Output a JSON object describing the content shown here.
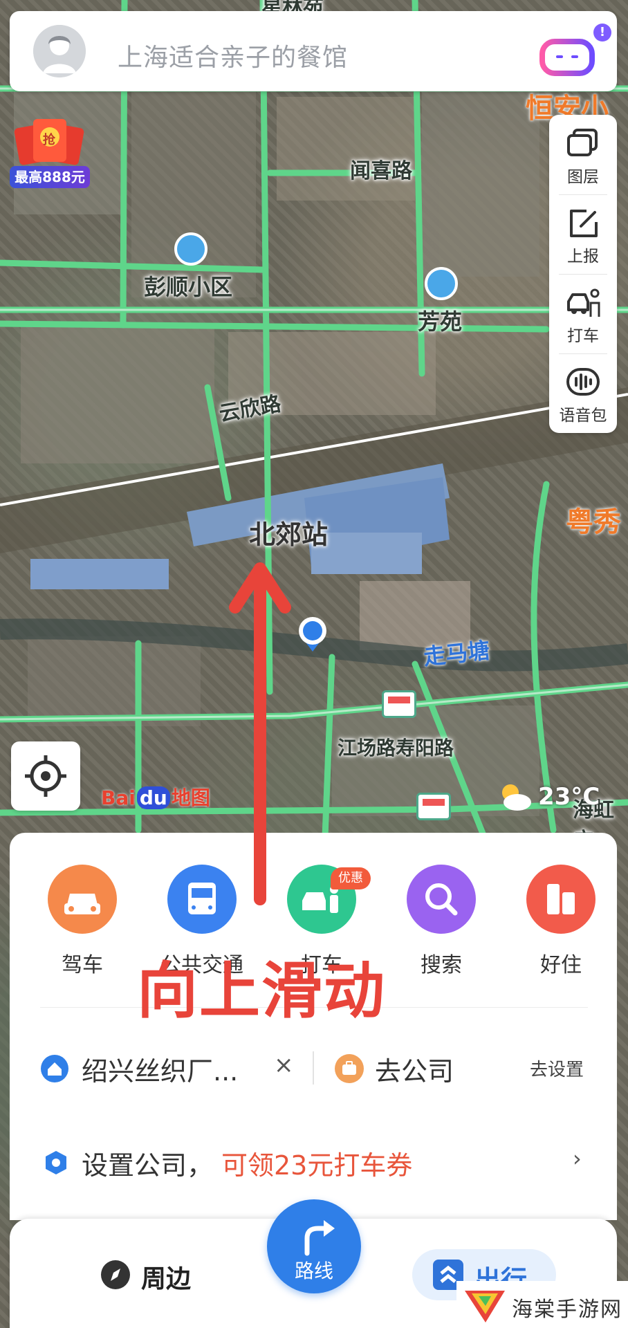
{
  "search": {
    "placeholder": "上海适合亲子的餐馆",
    "assistant_badge": "!"
  },
  "promo": {
    "label": "最高888元",
    "envelope_text": "抢"
  },
  "toolbar": {
    "items": [
      {
        "label": "图层",
        "icon": "layers-icon"
      },
      {
        "label": "上报",
        "icon": "report-icon"
      },
      {
        "label": "打车",
        "icon": "taxi-icon"
      },
      {
        "label": "语音包",
        "icon": "voice-pack-icon"
      }
    ]
  },
  "map": {
    "labels": {
      "top_partial": "星林苑",
      "top_right_partial": "恒安小",
      "wenxi_road": "闻喜路",
      "pengshun": "彭顺小区",
      "fangyuan": "芳苑",
      "yunxin_road": "云欣路",
      "beijiao_station": "北郊站",
      "yuexiu_partial": "粤秀",
      "zoumatang": "走马塘",
      "jiangchang": "江场路寿阳路",
      "haihong_partial": "海虹广"
    },
    "baidu_logo": {
      "bai": "Bai",
      "du": "du",
      "ditu": "地图"
    },
    "weather": {
      "temperature": "23°C",
      "icon": "partly-cloudy-icon"
    }
  },
  "quick_actions": [
    {
      "label": "驾车",
      "icon": "car-icon",
      "color": "#f5894b"
    },
    {
      "label": "公共交通",
      "icon": "bus-icon",
      "color": "#3b82f0"
    },
    {
      "label": "打车",
      "icon": "taxi-person-icon",
      "color": "#2ec790",
      "badge": "优惠"
    },
    {
      "label": "搜索",
      "icon": "search-icon",
      "color": "#9a63f0"
    },
    {
      "label": "好住",
      "icon": "hotel-icon",
      "color": "#f25b4b"
    }
  ],
  "favorites": {
    "home": {
      "text": "绍兴丝织厂...",
      "clear": "×"
    },
    "work": {
      "text": "去公司",
      "setting": "去设置"
    }
  },
  "company_prompt": {
    "text": "设置公司，",
    "offer": "可领23元打车券",
    "chevron": "›"
  },
  "bottom_nav": {
    "nearby": "周边",
    "route": "路线",
    "travel": "出行"
  },
  "overlay": {
    "instruction": "向上滑动"
  },
  "watermark": {
    "text": "海棠手游网"
  },
  "colors": {
    "road_green": "#5fd58a",
    "accent_blue": "#2f7fe8",
    "offer_red": "#e8553b",
    "overlay_red": "#e8443a"
  }
}
